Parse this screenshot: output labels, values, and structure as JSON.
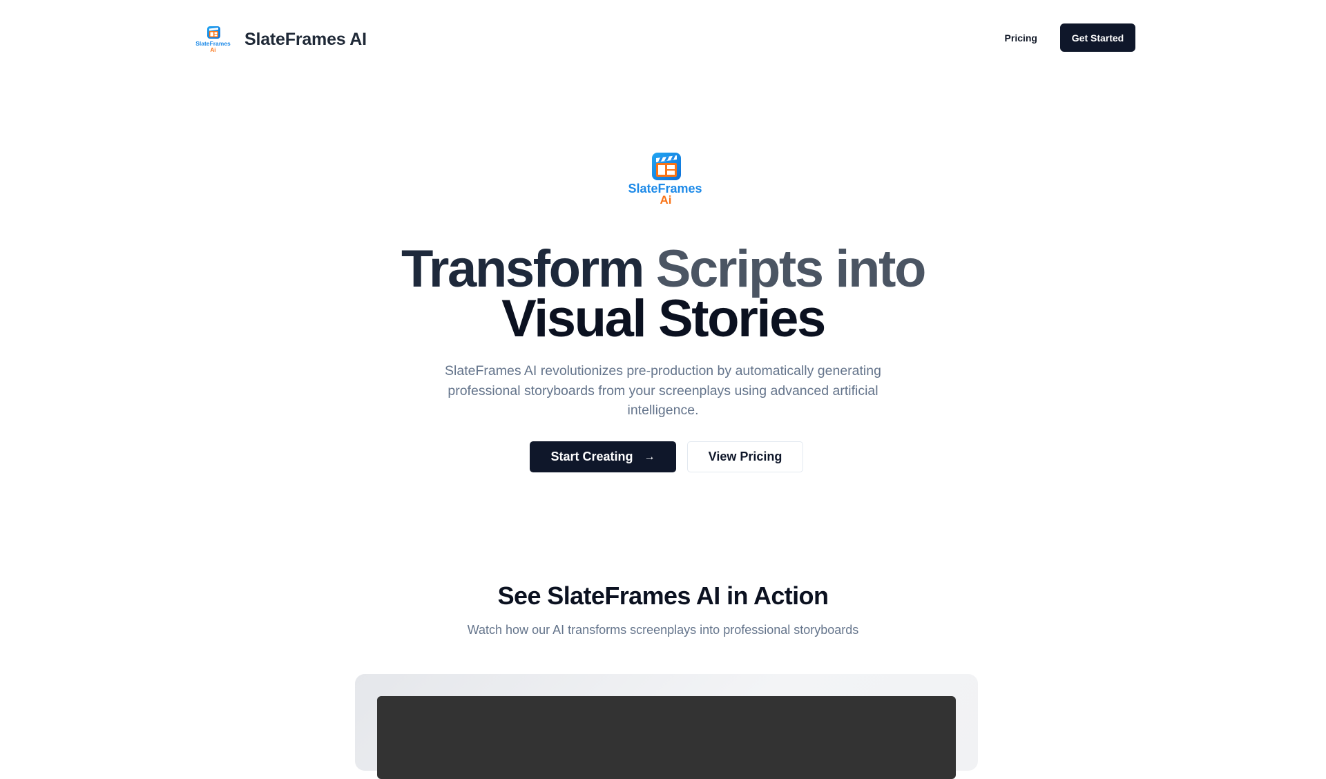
{
  "brand": {
    "name": "SlateFrames AI",
    "logo_word": "SlateFrames",
    "logo_sub": "Ai"
  },
  "nav": {
    "pricing": "Pricing",
    "get_started": "Get Started"
  },
  "hero": {
    "title_word1": "Transform",
    "title_word2": "Scripts into",
    "title_line2": "Visual Stories",
    "subtitle": "SlateFrames AI revolutionizes pre-production by automatically generating professional storyboards from your screenplays using advanced artificial intelligence.",
    "primary_cta": "Start Creating",
    "primary_cta_icon": "arrow-right-icon",
    "secondary_cta": "View Pricing"
  },
  "demo": {
    "title": "See SlateFrames AI in Action",
    "subtitle": "Watch how our AI transforms screenplays into professional storyboards"
  },
  "colors": {
    "logo_blue": "#1d8ae8",
    "logo_orange": "#f97316",
    "primary": "#0f172a",
    "muted_text": "#64748b"
  }
}
